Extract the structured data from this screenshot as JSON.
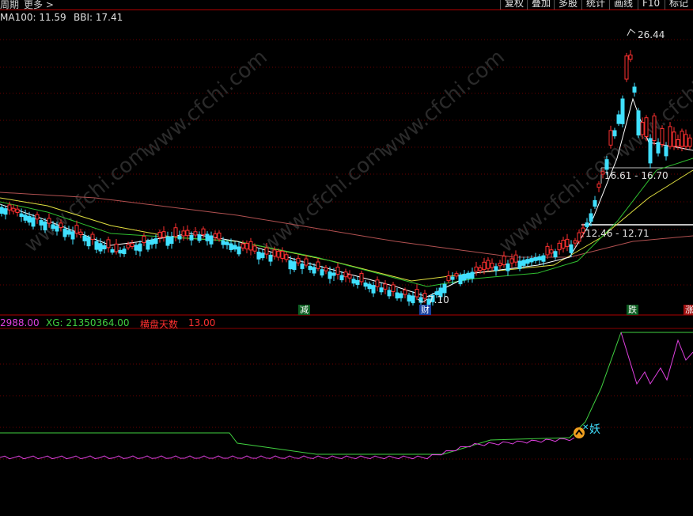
{
  "topbar": {
    "period_label": "周期",
    "more_label": "更多 >",
    "buttons": [
      "复权",
      "叠加",
      "多股",
      "统计",
      "画线",
      "F10",
      "标记"
    ]
  },
  "main_info": {
    "ma100": "MA100: 11.59",
    "bbi": "BBI: 17.41"
  },
  "sub_info": {
    "prefix": "2988.00",
    "xg": "XG: 21350364.00",
    "sideways_label": "横盘天数",
    "sideways_value": "13.00"
  },
  "price_labels": {
    "high": "26.44",
    "low": "7.10",
    "zone_upper": "16.61 - 16.70",
    "zone_lower": "12.46 - 12.71"
  },
  "event_marks": [
    {
      "text": "减",
      "color": "#ffffff",
      "bg": "#0c5c20"
    },
    {
      "text": "财",
      "color": "#ffffff",
      "bg": "#1840a0"
    },
    {
      "text": "跌",
      "color": "#ffffff",
      "bg": "#0c5c20"
    },
    {
      "text": "涨",
      "color": "#ffffff",
      "bg": "#a01010"
    }
  ],
  "signal_label": "妖",
  "colors": {
    "up": "#ff3030",
    "down": "#40e0ff",
    "ma_white": "#ffffff",
    "ma_yellow": "#e0e040",
    "ma_green": "#30c030",
    "ma_pink": "#b05050",
    "xg_green": "#40d040",
    "sub_magenta": "#e040e0"
  }
}
